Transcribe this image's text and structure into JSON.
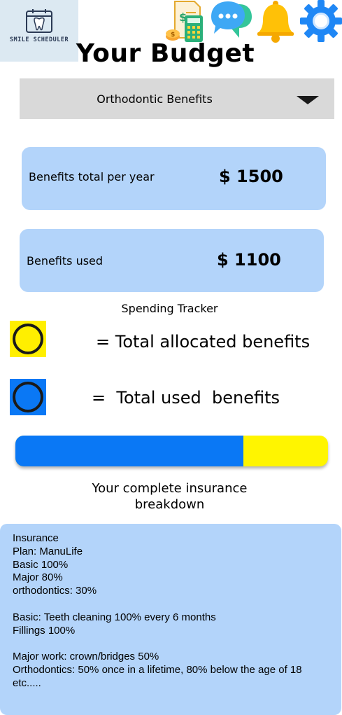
{
  "logo": {
    "text": "SMILE SCHEDULER",
    "icon": "tooth-calendar-icon"
  },
  "top_icons": [
    "budget-calculator-icon",
    "chat-icon",
    "bell-icon",
    "gear-icon"
  ],
  "page_title": "Your Budget",
  "dropdown": {
    "selected": "Orthodontic Benefits"
  },
  "cards": {
    "total": {
      "label": "Benefits total per year",
      "value": "$ 1500"
    },
    "used": {
      "label": "Benefits used",
      "value": "$ 1100"
    }
  },
  "tracker": {
    "title": "Spending Tracker",
    "legend": {
      "allocated": {
        "text": "= Total allocated benefits",
        "color": "#ffef00"
      },
      "used": {
        "text": "=  Total used  benefits",
        "color": "#0a78f5"
      }
    },
    "used_fraction": 0.73
  },
  "breakdown": {
    "title_line1": "Your complete insurance",
    "title_line2": "breakdown",
    "lines": [
      "Insurance",
      "Plan: ManuLife",
      "Basic 100%",
      "Major 80%",
      "orthodontics: 30%",
      "",
      "Basic: Teeth cleaning 100% every 6 months",
      "Fillings 100%",
      "",
      "Major work: crown/bridges 50%",
      "Orthodontics: 50% once in a lifetime, 80% below the age of 18",
      "etc....."
    ]
  }
}
